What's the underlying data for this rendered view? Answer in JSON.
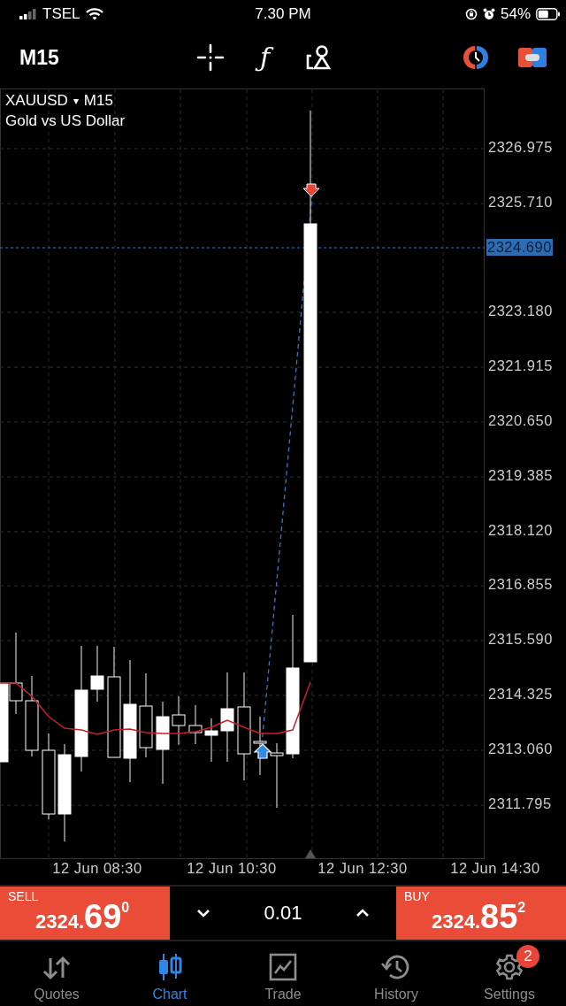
{
  "status_bar": {
    "carrier": "TSEL",
    "time": "7.30 PM",
    "battery": "54%"
  },
  "toolbar": {
    "timeframe": "M15",
    "function_glyph": "ƒ"
  },
  "chart": {
    "symbol": "XAUUSD",
    "dropdown_glyph": "▾",
    "timeframe": "M15",
    "description": "Gold vs US Dollar",
    "current_price": "2324.690",
    "price_ticks": [
      "2326.975",
      "2325.710",
      "2323.180",
      "2321.915",
      "2320.650",
      "2319.385",
      "2318.120",
      "2316.855",
      "2315.590",
      "2314.325",
      "2313.060",
      "2311.795"
    ],
    "time_ticks": [
      "12 Jun 08:30",
      "12 Jun 10:30",
      "12 Jun 12:30",
      "12 Jun 14:30"
    ]
  },
  "trade_bar": {
    "sell": {
      "label": "SELL",
      "price_main": "2324.",
      "price_big": "69",
      "price_sup": "0"
    },
    "volume": "0.01",
    "buy": {
      "label": "BUY",
      "price_main": "2324.",
      "price_big": "85",
      "price_sup": "2"
    }
  },
  "tabs": [
    {
      "label": "Quotes",
      "kind": "quotes",
      "selected": false
    },
    {
      "label": "Chart",
      "kind": "chart",
      "selected": true
    },
    {
      "label": "Trade",
      "kind": "trade",
      "selected": false
    },
    {
      "label": "History",
      "kind": "history",
      "selected": false
    },
    {
      "label": "Settings",
      "kind": "settings",
      "selected": false,
      "badge": "2"
    }
  ]
}
